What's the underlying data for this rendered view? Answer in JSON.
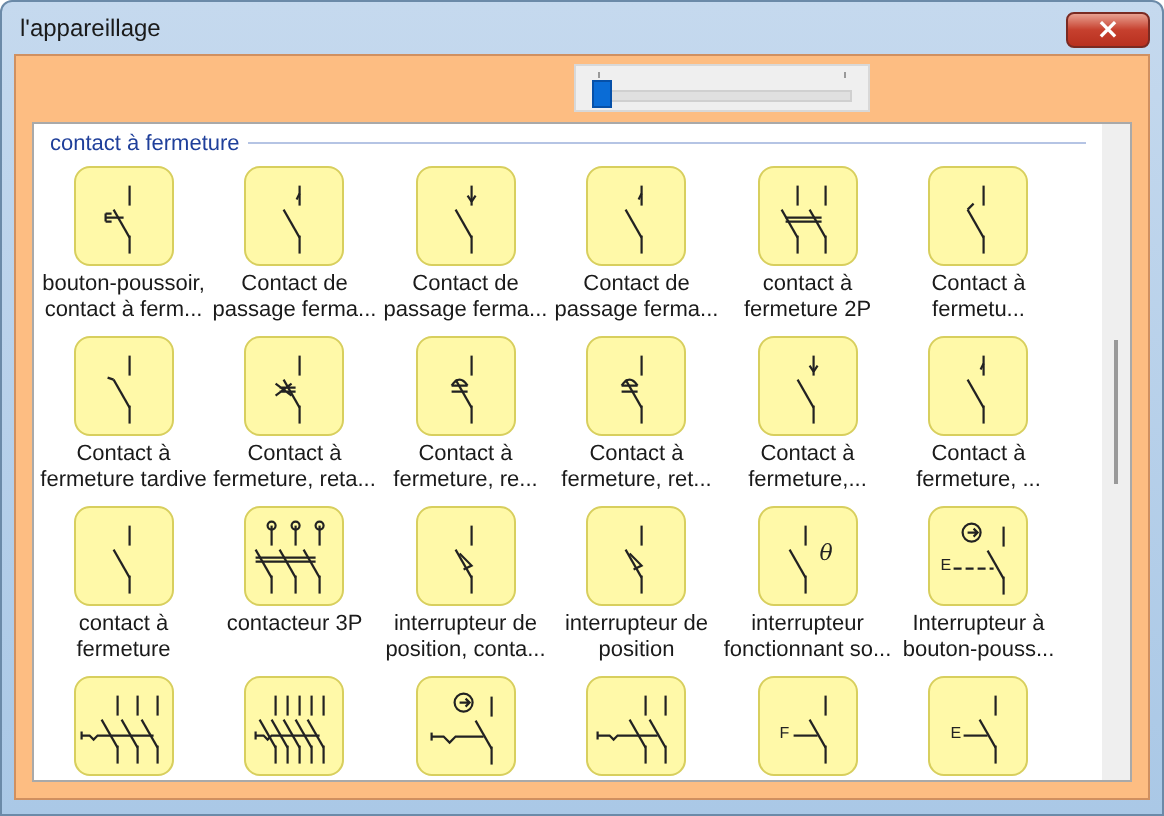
{
  "window": {
    "title": "l'appareillage",
    "close": "×"
  },
  "zoom_slider": {
    "level": 0.02
  },
  "group": {
    "title": "contact à fermeture",
    "items": [
      {
        "kind": "pushbutton",
        "label": "bouton-poussoir,\ncontact à ferm..."
      },
      {
        "kind": "passage",
        "label": "Contact de\npassage ferma..."
      },
      {
        "kind": "passage-arrow",
        "label": "Contact de\npassage ferma..."
      },
      {
        "kind": "passage",
        "label": "Contact de\npassage ferma..."
      },
      {
        "kind": "contact-2p",
        "label": "contact à\nfermeture 2P"
      },
      {
        "kind": "hook",
        "label": "Contact à\nfermetu..."
      },
      {
        "kind": "late",
        "label": "Contact à\nfermeture tardive"
      },
      {
        "kind": "delay-x",
        "label": "Contact à\nfermeture, reta..."
      },
      {
        "kind": "delay",
        "label": "Contact à\nfermeture, re..."
      },
      {
        "kind": "delay",
        "label": "Contact à\nfermeture, ret..."
      },
      {
        "kind": "passage-arrow",
        "label": "Contact à\nfermeture,..."
      },
      {
        "kind": "passage",
        "label": "Contact à\nfermeture, ..."
      },
      {
        "kind": "contact",
        "label": "contact à\nfermeture"
      },
      {
        "kind": "contact-3p",
        "label": "contacteur 3P"
      },
      {
        "kind": "position",
        "label": "interrupteur de\nposition, conta..."
      },
      {
        "kind": "position",
        "label": "interrupteur de\nposition"
      },
      {
        "kind": "lettered",
        "symbol": "θ",
        "label": "interrupteur\nfonctionnant so..."
      },
      {
        "kind": "rotary",
        "symbol": "E",
        "label": "Interrupteur à\nbouton-pouss..."
      },
      {
        "kind": "multi-3"
      },
      {
        "kind": "multi-5"
      },
      {
        "kind": "rotary-left"
      },
      {
        "kind": "multi-2"
      },
      {
        "kind": "linked",
        "symbol": "F"
      },
      {
        "kind": "linked",
        "symbol": "E"
      }
    ]
  }
}
